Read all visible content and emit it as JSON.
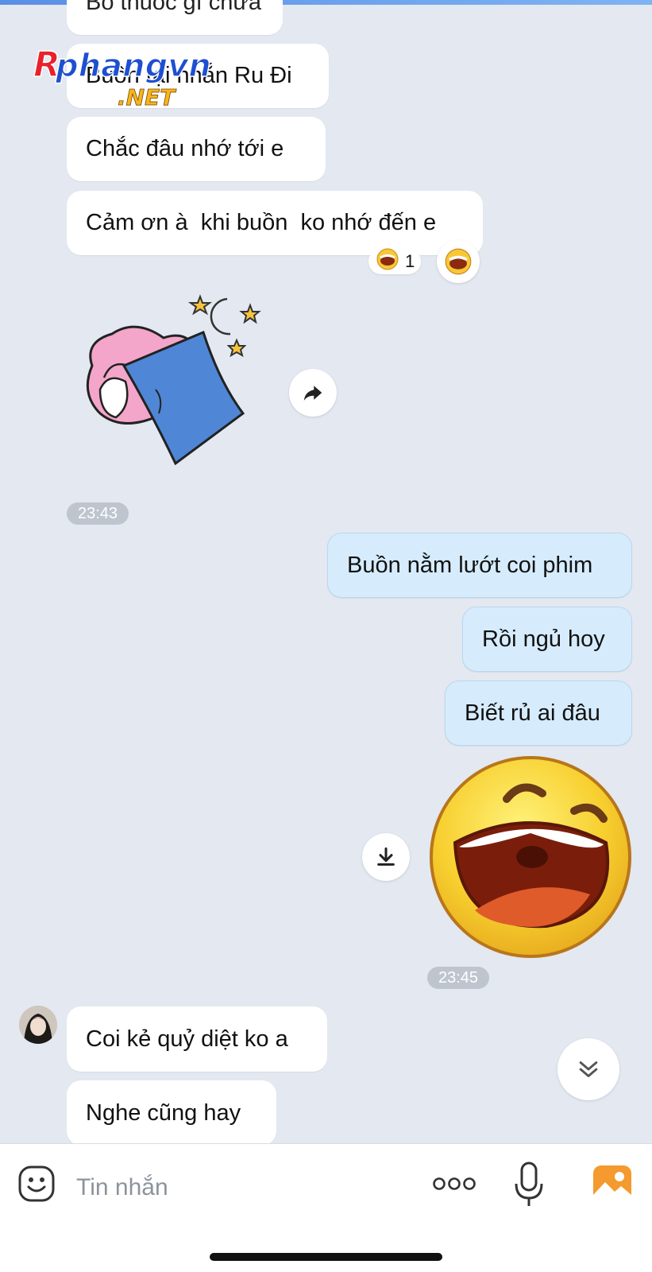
{
  "watermark": {
    "brand": "Rphangvn",
    "suffix": ".NET"
  },
  "messages_other_top": [
    {
      "text": "Bổ thuốc gì chưa"
    },
    {
      "text": "Buồn tại nhắn Ru Đi"
    },
    {
      "text": "Chắc đâu nhớ tới e"
    },
    {
      "text": "Cảm ơn à  khi buồn  ko nhớ đến e"
    }
  ],
  "reaction": {
    "icon": "laughing-emoji",
    "count": "1"
  },
  "timestamps": {
    "first": "23:43",
    "second": "23:45"
  },
  "messages_me": [
    {
      "text": "Buồn nằm lướt coi phim"
    },
    {
      "text": "Rồi ngủ hoy"
    },
    {
      "text": "Biết rủ ai đâu"
    }
  ],
  "messages_other_bottom": [
    {
      "text": "Coi kẻ quỷ diệt ko a"
    },
    {
      "text": "Nghe cũng hay"
    }
  ],
  "input": {
    "placeholder": "Tin nhắn"
  },
  "icons": {
    "forward": "share-arrow-icon",
    "download": "download-icon",
    "scroll_down": "double-chevron-down-icon",
    "emoji": "emoji-icon",
    "more": "more-dots-icon",
    "mic": "microphone-icon",
    "gallery": "gallery-icon"
  },
  "colors": {
    "background": "#e3e8f1",
    "my_bubble": "#d6ecfd",
    "other_bubble": "#ffffff",
    "gallery_orange": "#f49a2e"
  }
}
